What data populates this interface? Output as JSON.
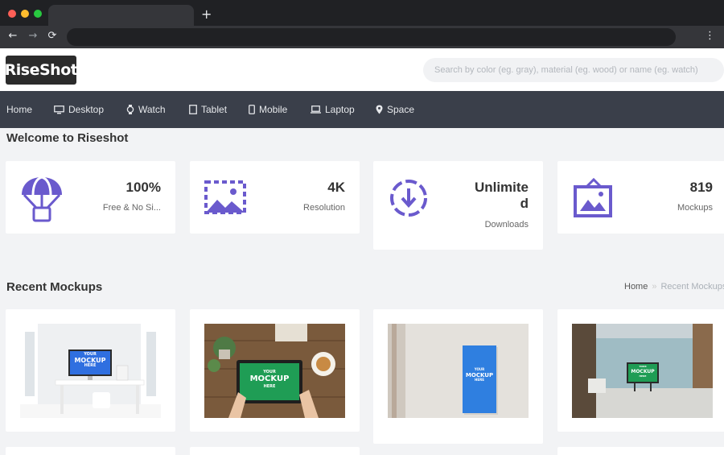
{
  "browser": {
    "new_tab": "+",
    "back": "←",
    "forward": "→",
    "reload": "⟳",
    "menu": "⋮"
  },
  "header": {
    "logo": "RiseShot",
    "search_placeholder": "Search by color (eg. gray), material (eg. wood) or name (eg. watch)"
  },
  "nav": [
    {
      "label": "Home",
      "icon": "none"
    },
    {
      "label": "Desktop",
      "icon": "monitor-icon"
    },
    {
      "label": "Watch",
      "icon": "watch-icon"
    },
    {
      "label": "Tablet",
      "icon": "tablet-icon"
    },
    {
      "label": "Mobile",
      "icon": "mobile-icon"
    },
    {
      "label": "Laptop",
      "icon": "laptop-icon"
    },
    {
      "label": "Space",
      "icon": "map-pin-icon"
    }
  ],
  "welcome_title": "Welcome to Riseshot",
  "stats": [
    {
      "value": "100%",
      "label": "Free & No Si...",
      "icon": "parachute-icon"
    },
    {
      "value": "4K",
      "label": "Resolution",
      "icon": "image-frame-icon"
    },
    {
      "value_line1": "Unlimite",
      "value_line2": "d",
      "label": "Downloads",
      "icon": "download-circle-icon"
    },
    {
      "value": "819",
      "label": "Mockups",
      "icon": "picture-frame-icon"
    }
  ],
  "recent_title": "Recent Mockups",
  "breadcrumb": {
    "home": "Home",
    "separator": "»",
    "current": "Recent Mockups"
  },
  "mockups": [
    {
      "caption_top": "YOUR",
      "caption_main": "MOCKUP",
      "caption_bottom": "HERE"
    },
    {
      "caption_top": "YOUR",
      "caption_main": "MOCKUP",
      "caption_bottom": "HERE"
    },
    {
      "caption_top": "YOUR",
      "caption_main": "MOCKUP",
      "caption_bottom": "HERE"
    },
    {
      "caption_top": "YOUR",
      "caption_main": "MOCKUP",
      "caption_bottom": "HERE"
    }
  ],
  "colors": {
    "accent": "#6a5acd",
    "nav_bg": "#3a3f4a",
    "page_bg": "#f2f3f5",
    "mockup_blue": "#2f6fe0",
    "mockup_green": "#1f9d55"
  }
}
